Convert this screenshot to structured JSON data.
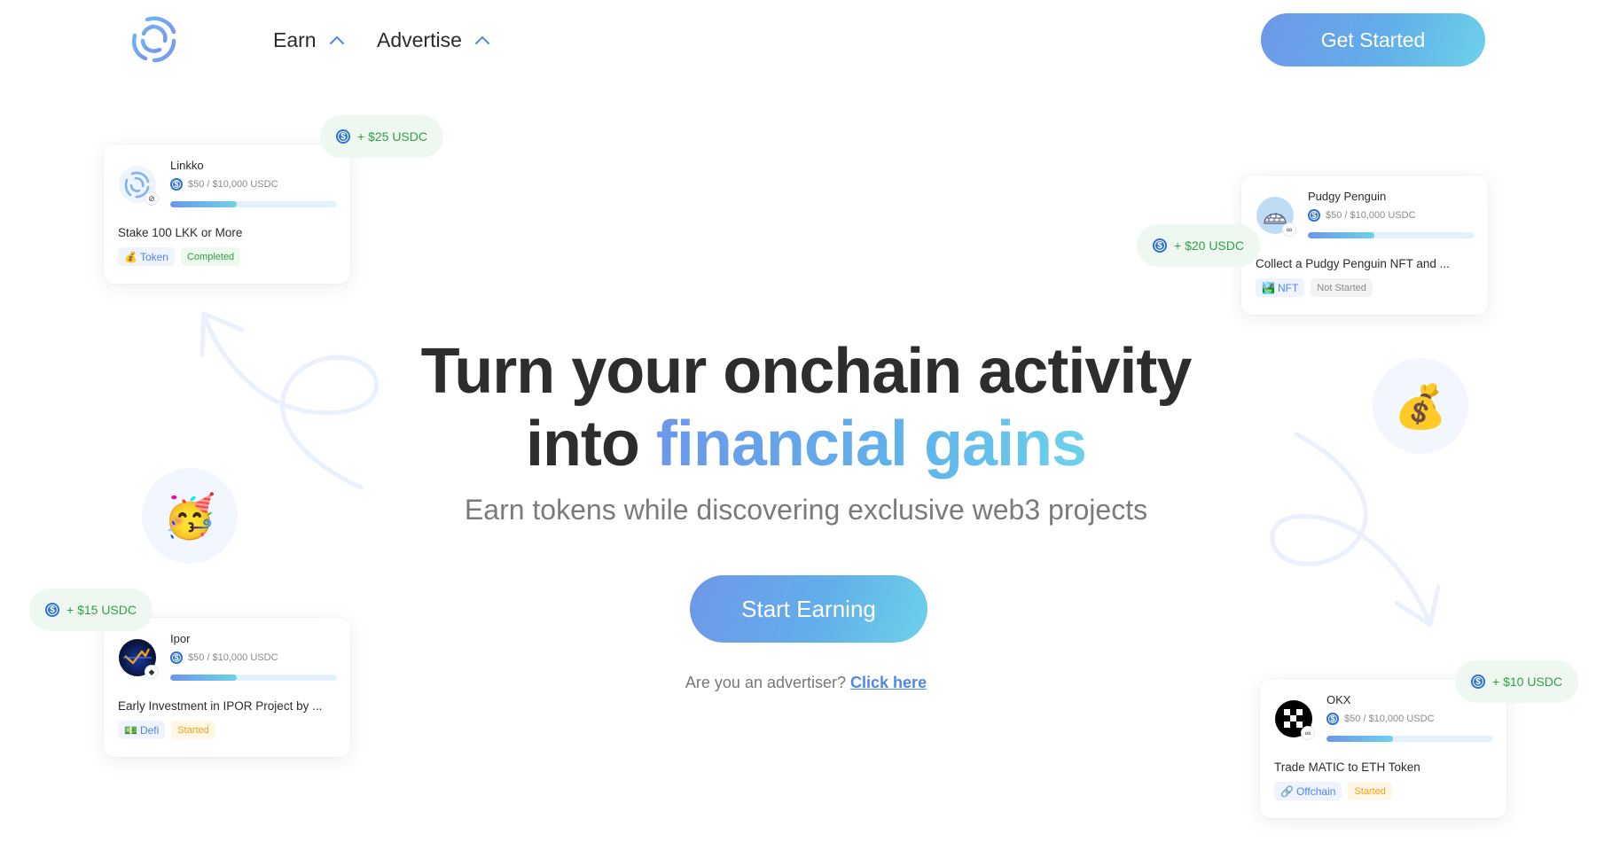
{
  "nav": {
    "logo_icon": "swirl-logo-icon",
    "items": [
      {
        "label": "Earn",
        "icon": "chevron-up-icon"
      },
      {
        "label": "Advertise",
        "icon": "chevron-up-icon"
      }
    ],
    "cta_label": "Get Started"
  },
  "hero": {
    "title_line1": "Turn your onchain activity",
    "title_line2_plain": "into",
    "title_line2_highlight": "financial gains",
    "subtitle": "Earn tokens while discovering exclusive web3 projects",
    "cta_label": "Start Earning",
    "advertiser_prompt": "Are you an advertiser?",
    "advertiser_link": "Click here"
  },
  "decor": {
    "party_emoji": "🥳",
    "money_emoji": "💰"
  },
  "colors": {
    "accent_gradient_start": "#6b97ea",
    "accent_gradient_end": "#6dd2ea",
    "reward_green": "#2ea043",
    "link_blue": "#4f86ea"
  },
  "cards": [
    {
      "name": "Linkko",
      "amount": "$50 / $10,000 USDC",
      "progress": 0.4,
      "task": "Stake 100 LKK or More",
      "category_emoji": "💰",
      "category": "Token",
      "status": "Completed",
      "reward": "+ $25 USDC"
    },
    {
      "name": "Pudgy Penguin",
      "amount": "$50 / $10,000 USDC",
      "progress": 0.4,
      "task": "Collect a Pudgy Penguin NFT and ...",
      "category_emoji": "🏞️",
      "category": "NFT",
      "status": "Not Started",
      "reward": "+ $20 USDC"
    },
    {
      "name": "Ipor",
      "amount": "$50 / $10,000 USDC",
      "progress": 0.4,
      "task": "Early Investment in IPOR Project by ...",
      "category_emoji": "💵",
      "category": "Defi",
      "status": "Started",
      "reward": "+ $15 USDC"
    },
    {
      "name": "OKX",
      "amount": "$50 / $10,000 USDC",
      "progress": 0.4,
      "task": "Trade MATIC to ETH Token",
      "category_emoji": "🔗",
      "category": "Offchain",
      "status": "Started",
      "reward": "+ $10 USDC"
    }
  ]
}
